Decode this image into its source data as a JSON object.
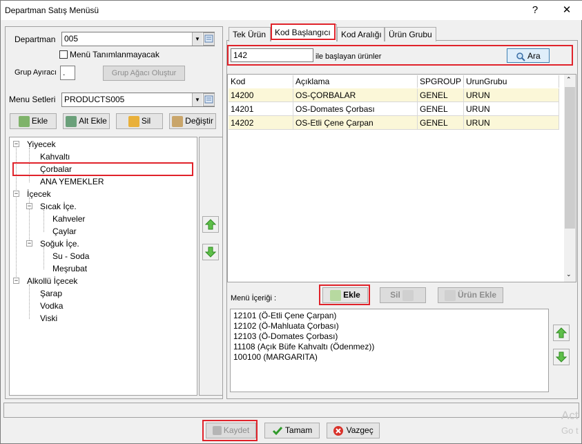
{
  "window": {
    "title": "Departman Satış Menüsü",
    "help": "?",
    "close": "✕"
  },
  "left": {
    "departman_label": "Departman",
    "departman_value": "005",
    "menu_check_label": "Menü Tanımlanmayacak",
    "grup_label": "Grup Ayıracı",
    "grup_value": ".",
    "grup_button": "Grup Ağacı Oluştur",
    "menu_label": "Menu Setleri",
    "menu_value": "PRODUCTS005",
    "buttons": {
      "ekle": "Ekle",
      "alt_ekle": "Alt Ekle",
      "sil": "Sil",
      "degistir": "Değiştir"
    },
    "tree": [
      "Yiyecek",
      "Kahvaltı",
      "Çorbalar",
      "ANA YEMEKLER",
      "İçecek",
      "Sıcak İçe.",
      "Kahveler",
      "Çaylar",
      "Soğuk İçe.",
      "Su - Soda",
      "Meşrubat",
      "Alkollü İçecek",
      "Şarap",
      "Vodka",
      "Viski"
    ]
  },
  "tabs": [
    "Tek Ürün",
    "Kod Başlangıcı",
    "Kod Aralığı",
    "Ürün Grubu"
  ],
  "search": {
    "value": "142",
    "suffix": "ile başlayan ürünler",
    "button": "Ara"
  },
  "grid": {
    "columns": [
      "Kod",
      "Açıklama",
      "SPGROUP",
      "UrunGrubu"
    ],
    "rows": [
      [
        "14200",
        "OS-ÇORBALAR",
        "GENEL",
        "URUN"
      ],
      [
        "14201",
        "OS-Domates Çorbası",
        "GENEL",
        "URUN"
      ],
      [
        "14202",
        "OS-Etli Çene Çarpan",
        "GENEL",
        "URUN"
      ]
    ]
  },
  "menu_content": {
    "label": "Menü İçeriği :",
    "ekle": "Ekle",
    "sil": "Sil",
    "urun_ekle": "Ürün Ekle",
    "items": [
      "12101 (Ö-Etli Çene Çarpan)",
      "12102 (Ö-Mahluata Çorbası)",
      "12103 (Ö-Domates Çorbası)",
      "11108 (Açık Büfe Kahvaltı (Ödenmez))",
      "100100 (MARGARITA)"
    ]
  },
  "footer": {
    "kaydet": "Kaydet",
    "tamam": "Tamam",
    "vazgec": "Vazgeç",
    "watermark1": "Act",
    "watermark2": "Go t"
  },
  "colors": {
    "highlight_red": "#e0222a",
    "row_yellow": "#fbf7d8",
    "selection": "#cce4f7"
  }
}
